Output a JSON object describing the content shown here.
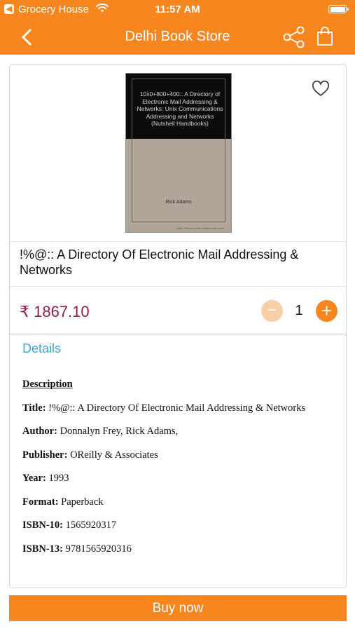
{
  "status_bar": {
    "back_glyph": "◀",
    "carrier": "Grocery House",
    "time": "11:57 AM"
  },
  "nav": {
    "title": "Delhi Book Store",
    "icons": [
      "back-chevron-icon",
      "share-icon",
      "shopping-bag-icon"
    ]
  },
  "product": {
    "cover": {
      "title": "10x0+800+400:: A Directory of Electronic Mail Addressing & Networks: Unix Communications Addressing and Networks (Nutshell Handbooks)",
      "author": "Rick Adams",
      "note": "Note: This is not the actual book cover"
    },
    "favorite_icon": "heart-outline-icon",
    "name": "!%@:: A Directory Of Electronic Mail Addressing & Networks",
    "price": "₹ 1867.10",
    "quantity": {
      "minus": "−",
      "value": "1",
      "plus": "+"
    }
  },
  "details": {
    "tab_label": "Details",
    "description_heading": "Description",
    "fields": [
      {
        "label": "Title:",
        "value": "!%@:: A Directory Of Electronic Mail Addressing & Networks"
      },
      {
        "label": "Author:",
        "value": "Donnalyn Frey, Rick Adams,"
      },
      {
        "label": "Publisher:",
        "value": "OReilly & Associates"
      },
      {
        "label": "Year:",
        "value": "1993"
      },
      {
        "label": "Format:",
        "value": "Paperback"
      },
      {
        "label": "ISBN-10:",
        "value": "1565920317"
      },
      {
        "label": "ISBN-13:",
        "value": "9781565920316"
      }
    ]
  },
  "buy_now": "Buy now",
  "colors": {
    "accent": "#f7861e",
    "price": "#8e1c4e",
    "link": "#3fa7d9",
    "minus_disabled": "#f9cfa8"
  }
}
